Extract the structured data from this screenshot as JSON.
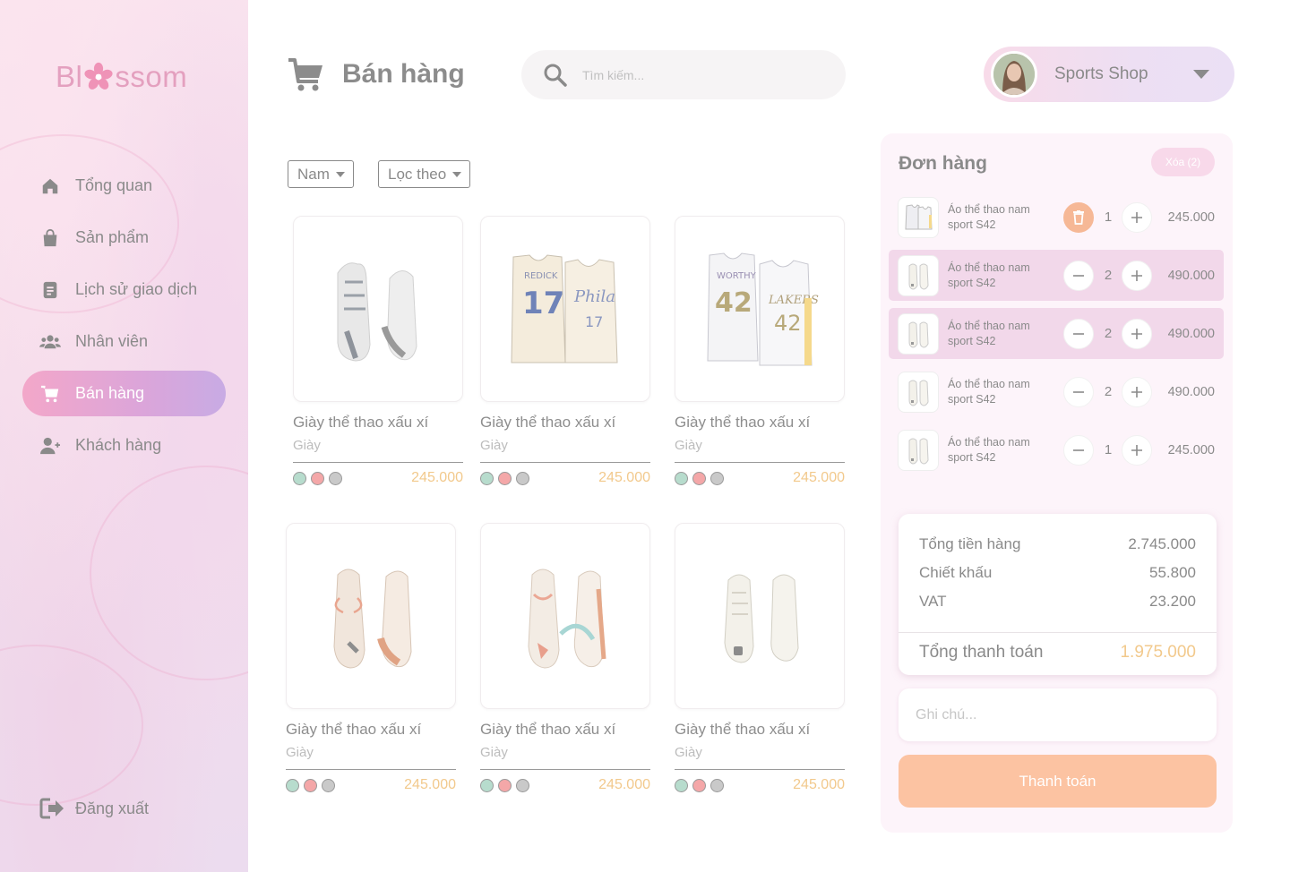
{
  "app": {
    "logo_text_left": "Bl",
    "logo_text_right": "ssom"
  },
  "sidebar": {
    "items": [
      {
        "label": "Tổng quan",
        "icon": "home-icon"
      },
      {
        "label": "Sản phẩm",
        "icon": "bag-icon"
      },
      {
        "label": "Lịch sử giao dịch",
        "icon": "document-icon"
      },
      {
        "label": "Nhân viên",
        "icon": "users-icon"
      },
      {
        "label": "Bán hàng",
        "icon": "cart-icon",
        "active": true
      },
      {
        "label": "Khách hàng",
        "icon": "add-user-icon"
      }
    ],
    "logout_label": "Đăng xuất"
  },
  "header": {
    "title": "Bán hàng",
    "search_placeholder": "Tìm kiếm...",
    "shop_name": "Sports Shop"
  },
  "filters": {
    "gender": "Nam",
    "sort": "Lọc theo"
  },
  "products": [
    {
      "name": "Giày thể thao xấu xí",
      "category": "Giày",
      "price": "245.000",
      "image": "grey-sneakers"
    },
    {
      "name": "Giày thể thao xấu xí",
      "category": "Giày",
      "price": "245.000",
      "image": "cream-jersey-17"
    },
    {
      "name": "Giày thể thao xấu xí",
      "category": "Giày",
      "price": "245.000",
      "image": "white-jersey-42"
    },
    {
      "name": "Giày thể thao xấu xí",
      "category": "Giày",
      "price": "245.000",
      "image": "peach-sneakers"
    },
    {
      "name": "Giày thể thao xấu xí",
      "category": "Giày",
      "price": "245.000",
      "image": "pastel-sneakers"
    },
    {
      "name": "Giày thể thao xấu xí",
      "category": "Giày",
      "price": "245.000",
      "image": "white-sneakers"
    }
  ],
  "swatch_colors": [
    "#b7dccd",
    "#f4a7a8",
    "#c9c9c9"
  ],
  "order": {
    "title": "Đơn hàng",
    "clear_label": "Xóa (2)",
    "items": [
      {
        "name_line1": "Áo thể thao nam",
        "name_line2": "sport S42",
        "qty": "1",
        "price": "245.000",
        "highlight": false,
        "minus_is_delete": true
      },
      {
        "name_line1": "Áo thể thao nam",
        "name_line2": "sport S42",
        "qty": "2",
        "price": "490.000",
        "highlight": true,
        "minus_is_delete": false
      },
      {
        "name_line1": "Áo thể thao nam",
        "name_line2": "sport S42",
        "qty": "2",
        "price": "490.000",
        "highlight": true,
        "minus_is_delete": false
      },
      {
        "name_line1": "Áo thể thao nam",
        "name_line2": "sport S42",
        "qty": "2",
        "price": "490.000",
        "highlight": false,
        "minus_is_delete": false
      },
      {
        "name_line1": "Áo thể thao nam",
        "name_line2": "sport S42",
        "qty": "1",
        "price": "245.000",
        "highlight": false,
        "minus_is_delete": false
      }
    ],
    "summary": {
      "subtotal_label": "Tổng tiền hàng",
      "subtotal": "2.745.000",
      "discount_label": "Chiết khấu",
      "discount": "55.800",
      "vat_label": "VAT",
      "vat": "23.200",
      "total_label": "Tổng thanh toán",
      "total": "1.975.000"
    },
    "note_placeholder": "Ghi chú...",
    "pay_label": "Thanh toán"
  },
  "colors": {
    "accent_pink": "#f3a7c9",
    "accent_purple": "#c8abe4",
    "price_gold": "#f2c98c",
    "pay_orange": "#fcc3a2",
    "order_bg": "#fdf4fa"
  }
}
